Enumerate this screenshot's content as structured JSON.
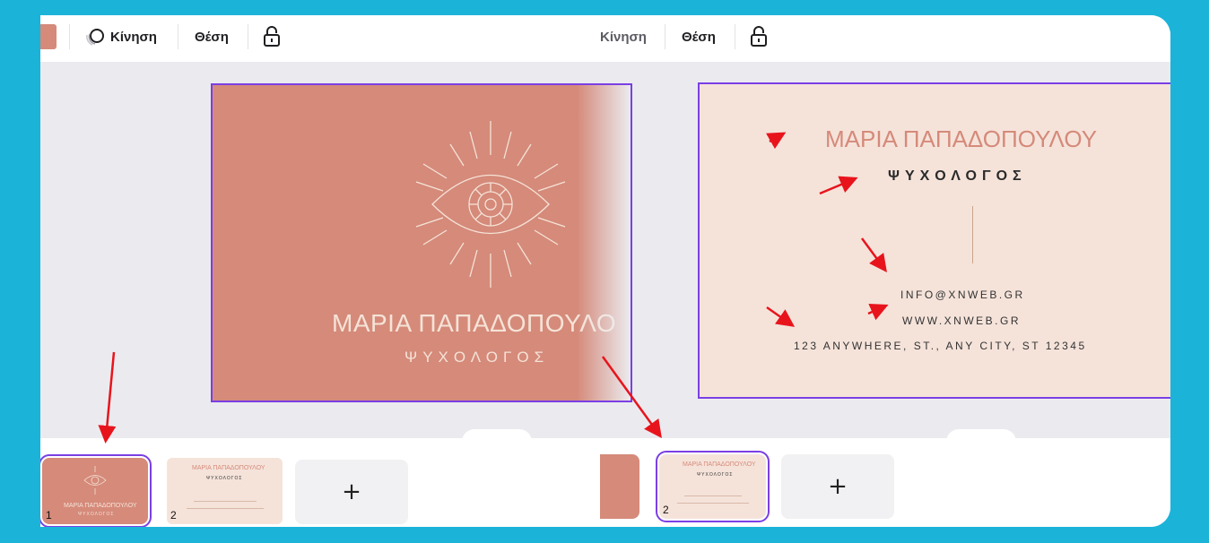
{
  "toolbar_left": {
    "motion_label": "Κίνηση",
    "position_label": "Θέση"
  },
  "toolbar_right": {
    "motion_label": "Κίνηση",
    "position_label": "Θέση"
  },
  "front_card": {
    "name": "ΜΑΡΙΑ ΠΑΠΑΔΟΠΟΥΛΟ",
    "role": "ΨΥΧΟΛΟΓΟΣ"
  },
  "back_card": {
    "name": "ΜΑΡΙΑ ΠΑΠΑΔΟΠΟΥΛΟΥ",
    "role": "ΨΥΧΟΛΟΓΟΣ",
    "email": "INFO@XNWEB.GR",
    "web": "WWW.XNWEB.GR",
    "address": "123 ANYWHERE, ST., ANY CITY, ST 12345"
  },
  "thumbnails_left": [
    {
      "number": "1",
      "name": "ΜΑΡΙΑ ΠΑΠΑΔΟΠΟΥΛΟΥ",
      "role": "ΨΥΧΟΛΟΓΟΣ"
    },
    {
      "number": "2",
      "name": "ΜΑΡΙΑ ΠΑΠΑΔΟΠΟΥΛΟΥ",
      "role": "ΨΥΧΟΛΟΓΟΣ"
    }
  ],
  "thumbnails_right": [
    {
      "number": "2",
      "name": "ΜΑΡΙΑ ΠΑΠΑΔΟΠΟΥΛΟΥ",
      "role": "ΨΥΧΟΛΟΓΟΣ"
    }
  ],
  "add_page_label": "+",
  "colors": {
    "accent": "#7b3fe4",
    "card_front": "#d58a7a",
    "card_back": "#f5e3da",
    "background": "#1cb3d9",
    "annotation": "#e8141c"
  }
}
